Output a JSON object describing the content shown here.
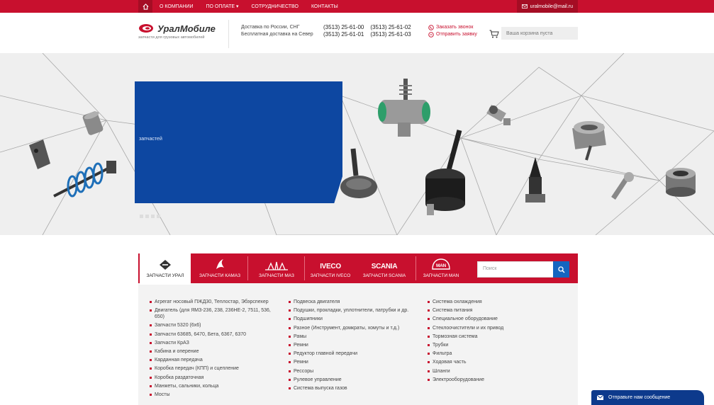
{
  "topbar": {
    "home_icon": "home-icon",
    "nav": [
      "О КОМПАНИИ",
      "ПО ОПЛАТЕ ▾",
      "СОТРУДНИЧЕСТВО",
      "КОНТАКТЫ"
    ],
    "email": "uralmobile@mail.ru"
  },
  "header": {
    "brand": "УралМобиле",
    "tagline": "запчасти для грузовых автомобилей",
    "delivery": [
      "Доставка по России, СНГ",
      "Бесплатная доставка на Север"
    ],
    "phones": [
      [
        "(3513) 25-61-00",
        "(3513) 25-61-02"
      ],
      [
        "(3513) 25-61-01",
        "(3513) 25-61-03"
      ]
    ],
    "links": [
      "Заказать звонок",
      "Отправить заявку"
    ],
    "cart": "Ваша корзина пуста"
  },
  "hero": {
    "caption": "запчастей"
  },
  "tabs": [
    {
      "icon": "ural-logo-icon",
      "label": "ЗАПЧАСТИ УРАЛ",
      "active": true
    },
    {
      "icon": "kamaz-logo-icon",
      "label": "ЗАПЧАСТИ КАМАЗ"
    },
    {
      "icon": "maz-logo-icon",
      "label": "ЗАПЧАСТИ МАЗ"
    },
    {
      "icon": "iveco-logo-icon",
      "brand": "IVECO",
      "label": "ЗАПЧАСТИ IVECO"
    },
    {
      "icon": "scania-logo-icon",
      "brand": "SCANIA",
      "label": "ЗАПЧАСТИ SCANIA"
    },
    {
      "icon": "man-logo-icon",
      "brand": "MAN",
      "label": "ЗАПЧАСТИ MAN"
    }
  ],
  "search": {
    "placeholder": "Поиск"
  },
  "columns": [
    [
      "Агрегат носовый ПЖД30, Теплостар, Эбэрспехер",
      "Двигатель (для ЯМЗ-236, 238, 236НЕ-2, 7511, 536, 650)",
      "Запчасти 5320 (6x6)",
      "Запчасти 63685, 6470, Бета, 6367, 6370",
      "Запчасти КрАЗ",
      "Кабина и оперение",
      "Карданная передача",
      "Коробка передач (КПП) и сцепление",
      "Коробка раздаточная",
      "Манжеты, сальники, кольца",
      "Мосты"
    ],
    [
      "Подвеска двигателя",
      "Подушки, прокладки, уплотнители, патрубки и др.",
      "Подшипники",
      "Разное (Инструмент, домкраты, хомуты и т.д.)",
      "Рамы",
      "Ремни",
      "Редуктор главной передачи",
      "Ремни",
      "Рессоры",
      "Рулевое управление",
      "Система выпуска газов"
    ],
    [
      "Система охлаждения",
      "Система питания",
      "Специальное оборудование",
      "Стеклоочистители и их привод",
      "Тормозная система",
      "Трубки",
      "Фильтра",
      "Ходовая часть",
      "Шланги",
      "Электрооборудование"
    ]
  ],
  "chat": {
    "label": "Отправьте нам сообщение"
  }
}
